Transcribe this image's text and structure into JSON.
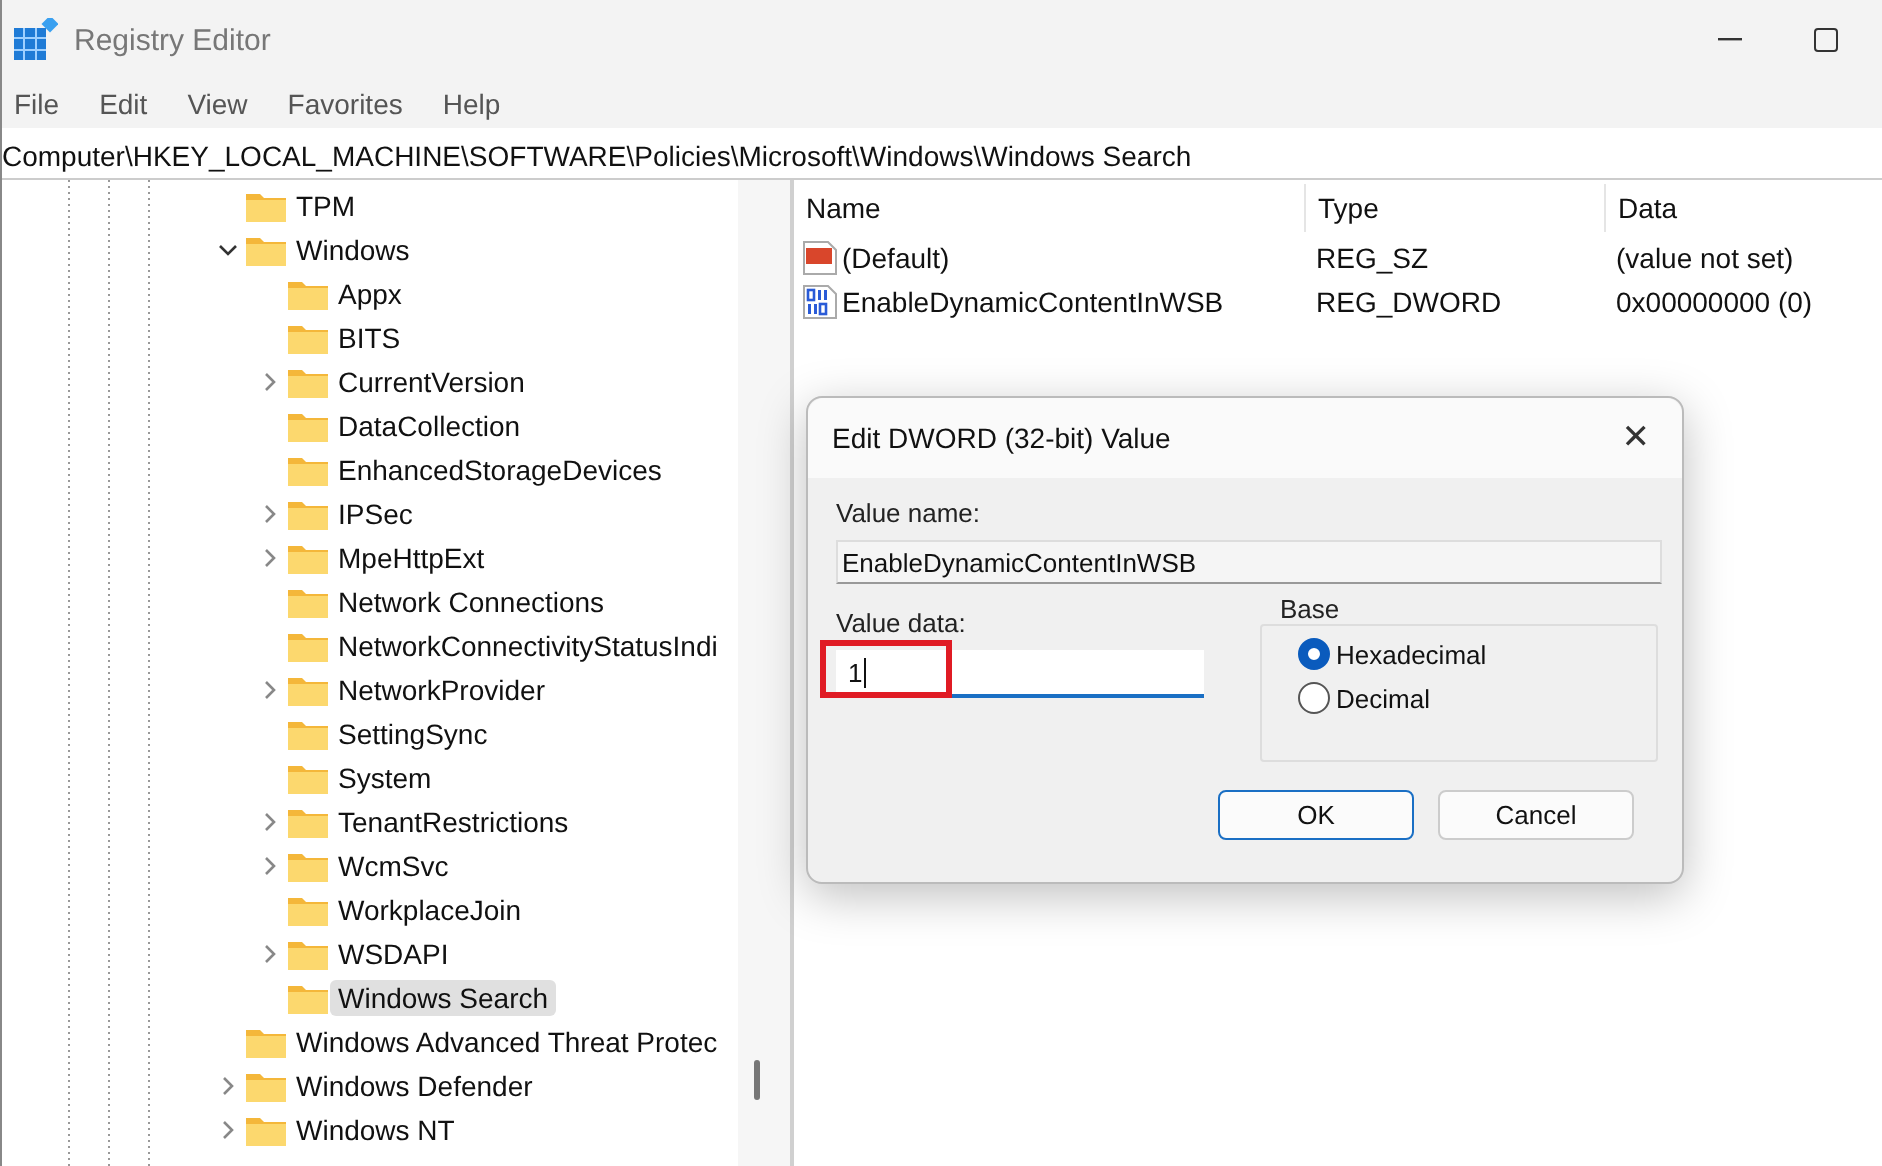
{
  "window": {
    "title": "Registry Editor"
  },
  "menu": [
    "File",
    "Edit",
    "View",
    "Favorites",
    "Help"
  ],
  "address": "Computer\\HKEY_LOCAL_MACHINE\\SOFTWARE\\Policies\\Microsoft\\Windows\\Windows Search",
  "tree": [
    {
      "label": "TPM",
      "expandable": false,
      "selected": false
    },
    {
      "label": "Windows",
      "expandable": true,
      "expanded": true,
      "selected": false,
      "children": [
        {
          "label": "Appx",
          "expandable": false,
          "selected": false
        },
        {
          "label": "BITS",
          "expandable": false,
          "selected": false
        },
        {
          "label": "CurrentVersion",
          "expandable": true,
          "expanded": false,
          "selected": false
        },
        {
          "label": "DataCollection",
          "expandable": false,
          "selected": false
        },
        {
          "label": "EnhancedStorageDevices",
          "expandable": false,
          "selected": false
        },
        {
          "label": "IPSec",
          "expandable": true,
          "expanded": false,
          "selected": false
        },
        {
          "label": "MpeHttpExt",
          "expandable": true,
          "expanded": false,
          "selected": false
        },
        {
          "label": "Network Connections",
          "expandable": false,
          "selected": false
        },
        {
          "label": "NetworkConnectivityStatusIndi",
          "expandable": false,
          "selected": false
        },
        {
          "label": "NetworkProvider",
          "expandable": true,
          "expanded": false,
          "selected": false
        },
        {
          "label": "SettingSync",
          "expandable": false,
          "selected": false
        },
        {
          "label": "System",
          "expandable": false,
          "selected": false
        },
        {
          "label": "TenantRestrictions",
          "expandable": true,
          "expanded": false,
          "selected": false
        },
        {
          "label": "WcmSvc",
          "expandable": true,
          "expanded": false,
          "selected": false
        },
        {
          "label": "WorkplaceJoin",
          "expandable": false,
          "selected": false
        },
        {
          "label": "WSDAPI",
          "expandable": true,
          "expanded": false,
          "selected": false
        },
        {
          "label": "Windows Search",
          "expandable": false,
          "selected": true
        }
      ]
    },
    {
      "label": "Windows Advanced Threat Protec",
      "expandable": false,
      "selected": false
    },
    {
      "label": "Windows Defender",
      "expandable": true,
      "expanded": false,
      "selected": false
    },
    {
      "label": "Windows NT",
      "expandable": true,
      "expanded": false,
      "selected": false
    }
  ],
  "values": {
    "columns": [
      "Name",
      "Type",
      "Data"
    ],
    "rows": [
      {
        "kind": "string",
        "name": "(Default)",
        "type": "REG_SZ",
        "data": "(value not set)"
      },
      {
        "kind": "binary",
        "name": "EnableDynamicContentInWSB",
        "type": "REG_DWORD",
        "data": "0x00000000 (0)"
      }
    ]
  },
  "dialog": {
    "title": "Edit DWORD (32-bit) Value",
    "close": "✕",
    "value_name_label": "Value name:",
    "value_name": "EnableDynamicContentInWSB",
    "value_data_label": "Value data:",
    "value_data": "1",
    "highlighted": true,
    "base": {
      "label": "Base",
      "options": [
        {
          "label": "Hexadecimal",
          "selected": true
        },
        {
          "label": "Decimal",
          "selected": false
        }
      ]
    },
    "buttons": [
      {
        "label": "OK",
        "default": true
      },
      {
        "label": "Cancel",
        "default": false
      }
    ]
  }
}
